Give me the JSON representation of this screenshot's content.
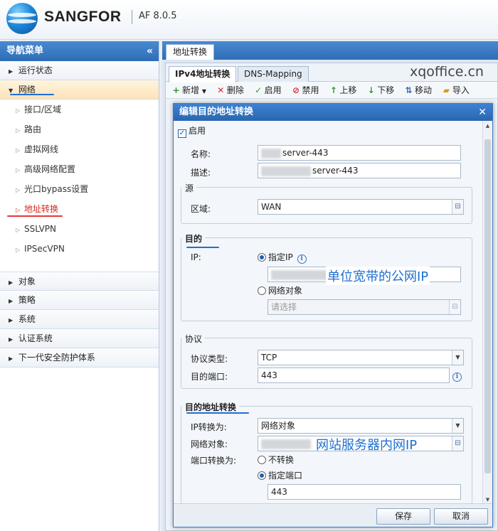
{
  "header": {
    "brand": "SANGFOR",
    "version": "AF 8.0.5"
  },
  "sidebar": {
    "title": "导航菜单",
    "collapse_icon": "«",
    "sections_top": [
      {
        "label": "运行状态",
        "expanded": false
      },
      {
        "label": "网络",
        "expanded": true
      }
    ],
    "network_items": [
      "接口/区域",
      "路由",
      "虚拟网线",
      "高级网络配置",
      "光口bypass设置",
      "地址转换",
      "SSLVPN",
      "IPSecVPN"
    ],
    "sections_bottom": [
      "对象",
      "策略",
      "系统",
      "认证系统",
      "下一代安全防护体系"
    ]
  },
  "main": {
    "tab": "地址转换",
    "subtabs": [
      "IPv4地址转换",
      "DNS-Mapping"
    ],
    "watermark": "xqoffice.cn",
    "toolbar": [
      "新增",
      "删除",
      "启用",
      "禁用",
      "上移",
      "下移",
      "移动",
      "导入"
    ]
  },
  "dialog": {
    "title": "编辑目的地址转换",
    "enable_label": "启用",
    "name_label": "名称:",
    "name_value": "server-443",
    "desc_label": "描述:",
    "desc_value": "server-443",
    "source_legend": "源",
    "zone_label": "区域:",
    "zone_value": "WAN",
    "dest_legend": "目的",
    "ip_label": "IP:",
    "specify_ip_label": "指定IP",
    "public_ip_annotation": "单位宽带的公网IP",
    "net_object_radio": "网络对象",
    "select_placeholder": "请选择",
    "protocol_legend": "协议",
    "protocol_type_label": "协议类型:",
    "protocol_value": "TCP",
    "dest_port_label": "目的端口:",
    "dest_port_value": "443",
    "dnat_legend": "目的地址转换",
    "ip_convert_label": "IP转换为:",
    "ip_convert_value": "网络对象",
    "net_object_label": "网络对象:",
    "internal_ip_annotation": "网站服务器内网IP",
    "port_convert_label": "端口转换为:",
    "no_convert_label": "不转换",
    "specify_port_label": "指定端口",
    "port_value": "443",
    "save_button": "保存",
    "cancel_button": "取消"
  },
  "colors": {
    "accent": "#2e6db6",
    "annotation": "#1e6fd0",
    "current_nav": "#d9281e"
  }
}
